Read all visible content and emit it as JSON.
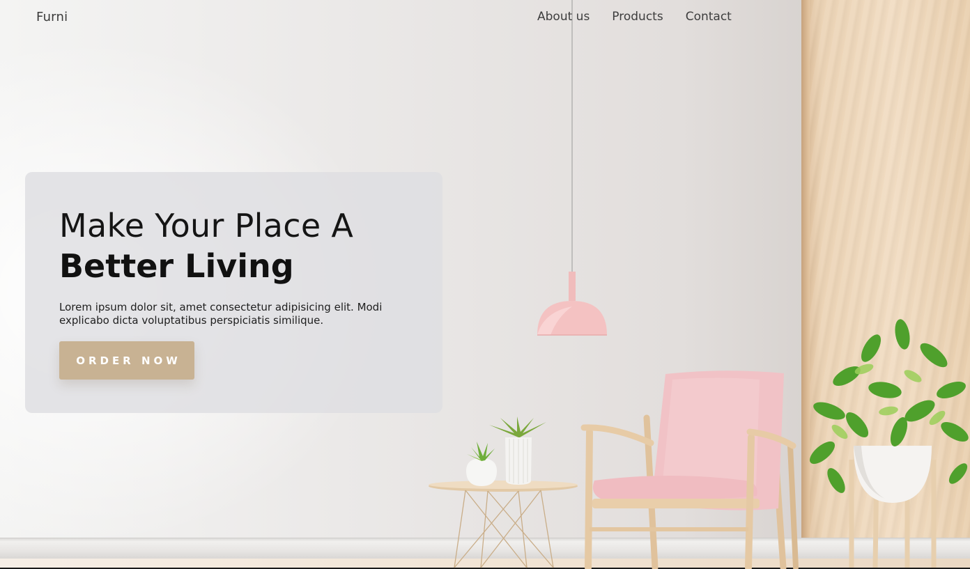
{
  "nav": {
    "brand": "Furni",
    "links": [
      {
        "label": "About us"
      },
      {
        "label": "Products"
      },
      {
        "label": "Contact"
      }
    ]
  },
  "hero": {
    "title_line1": "Make Your Place A",
    "title_line2": "Better Living",
    "description": "Lorem ipsum dolor sit, amet consectetur adipisicing elit. Modi explicabo dicta voluptatibus perspiciatis similique.",
    "cta_label": "ORDER NOW"
  },
  "colors": {
    "cta_background": "#c8b293",
    "hero_card_background": "#dedee2",
    "accent_pink": "#f2c4c4",
    "wood": "#ecd4b6"
  }
}
